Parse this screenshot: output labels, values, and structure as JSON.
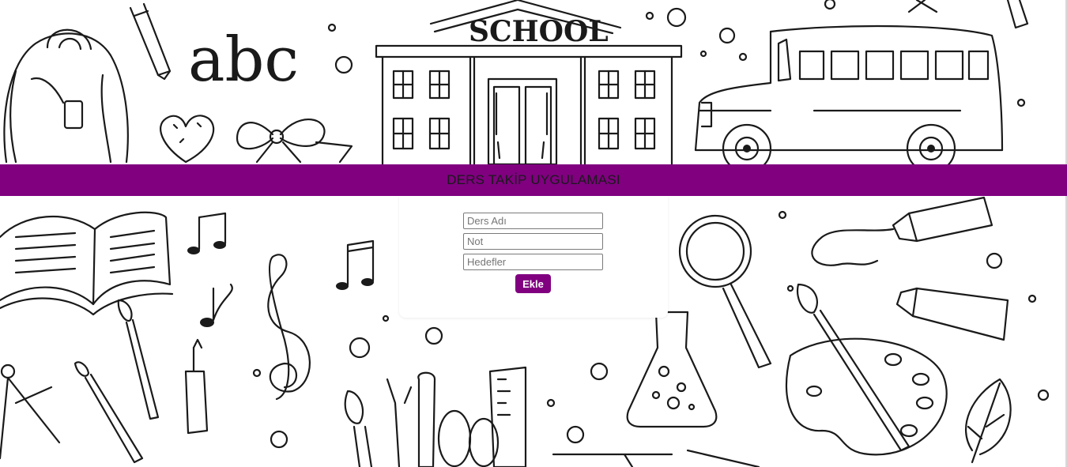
{
  "header": {
    "title": "DERS TAKİP UYGULAMASI"
  },
  "background": {
    "school_sign": "SCHOOL",
    "letters": "abc"
  },
  "form": {
    "course_name_placeholder": "Ders Adı",
    "grade_placeholder": "Not",
    "goals_placeholder": "Hedefler",
    "add_label": "Ekle"
  },
  "colors": {
    "accent": "#800080",
    "background": "#ffffff",
    "doodle_stroke": "#1a1a1a"
  }
}
